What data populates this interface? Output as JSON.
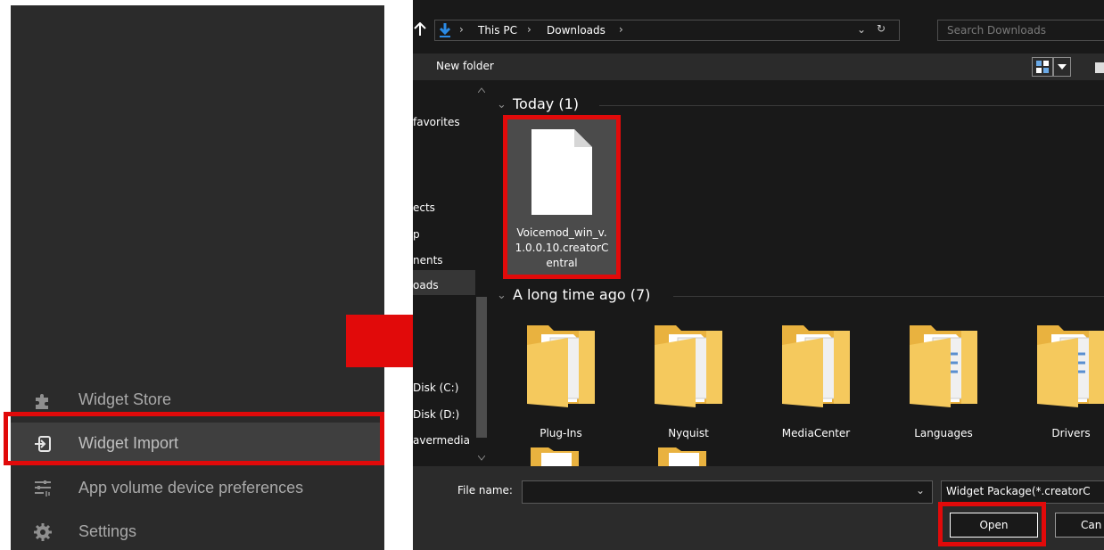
{
  "app_menu": {
    "items": [
      {
        "label": "Widget Store",
        "icon": "puzzle-icon"
      },
      {
        "label": "Widget Import",
        "icon": "import-icon",
        "active": true
      },
      {
        "label": "App volume device preferences",
        "icon": "sliders-icon"
      },
      {
        "label": "Settings",
        "icon": "gear-icon"
      }
    ]
  },
  "dialog": {
    "breadcrumb": [
      "This PC",
      "Downloads"
    ],
    "search_placeholder": "Search Downloads",
    "toolbar": {
      "new_folder": "New folder"
    },
    "nav_items": [
      "favorites",
      "ects",
      "p",
      "nents",
      "oads",
      "Disk (C:)",
      "Disk (D:)",
      "avermedia"
    ],
    "groups": [
      {
        "header": "Today (1)"
      },
      {
        "header": "A long time ago (7)"
      }
    ],
    "today_file": {
      "name_line1": "Voicemod_win_v.",
      "name_line2": "1.0.0.10.creatorC",
      "name_line3": "entral"
    },
    "folders": [
      "Plug-Ins",
      "Nyquist",
      "MediaCenter",
      "Languages",
      "Drivers"
    ],
    "file_name_label": "File name:",
    "file_name_value": "",
    "file_type": "Widget Package(*.creatorC",
    "open_label": "Open",
    "cancel_label": "Can"
  },
  "colors": {
    "highlight": "#e10a0a",
    "app_bg": "#2b2b2b",
    "dialog_bg": "#191919",
    "folder_yellow": "#f5c95d"
  }
}
